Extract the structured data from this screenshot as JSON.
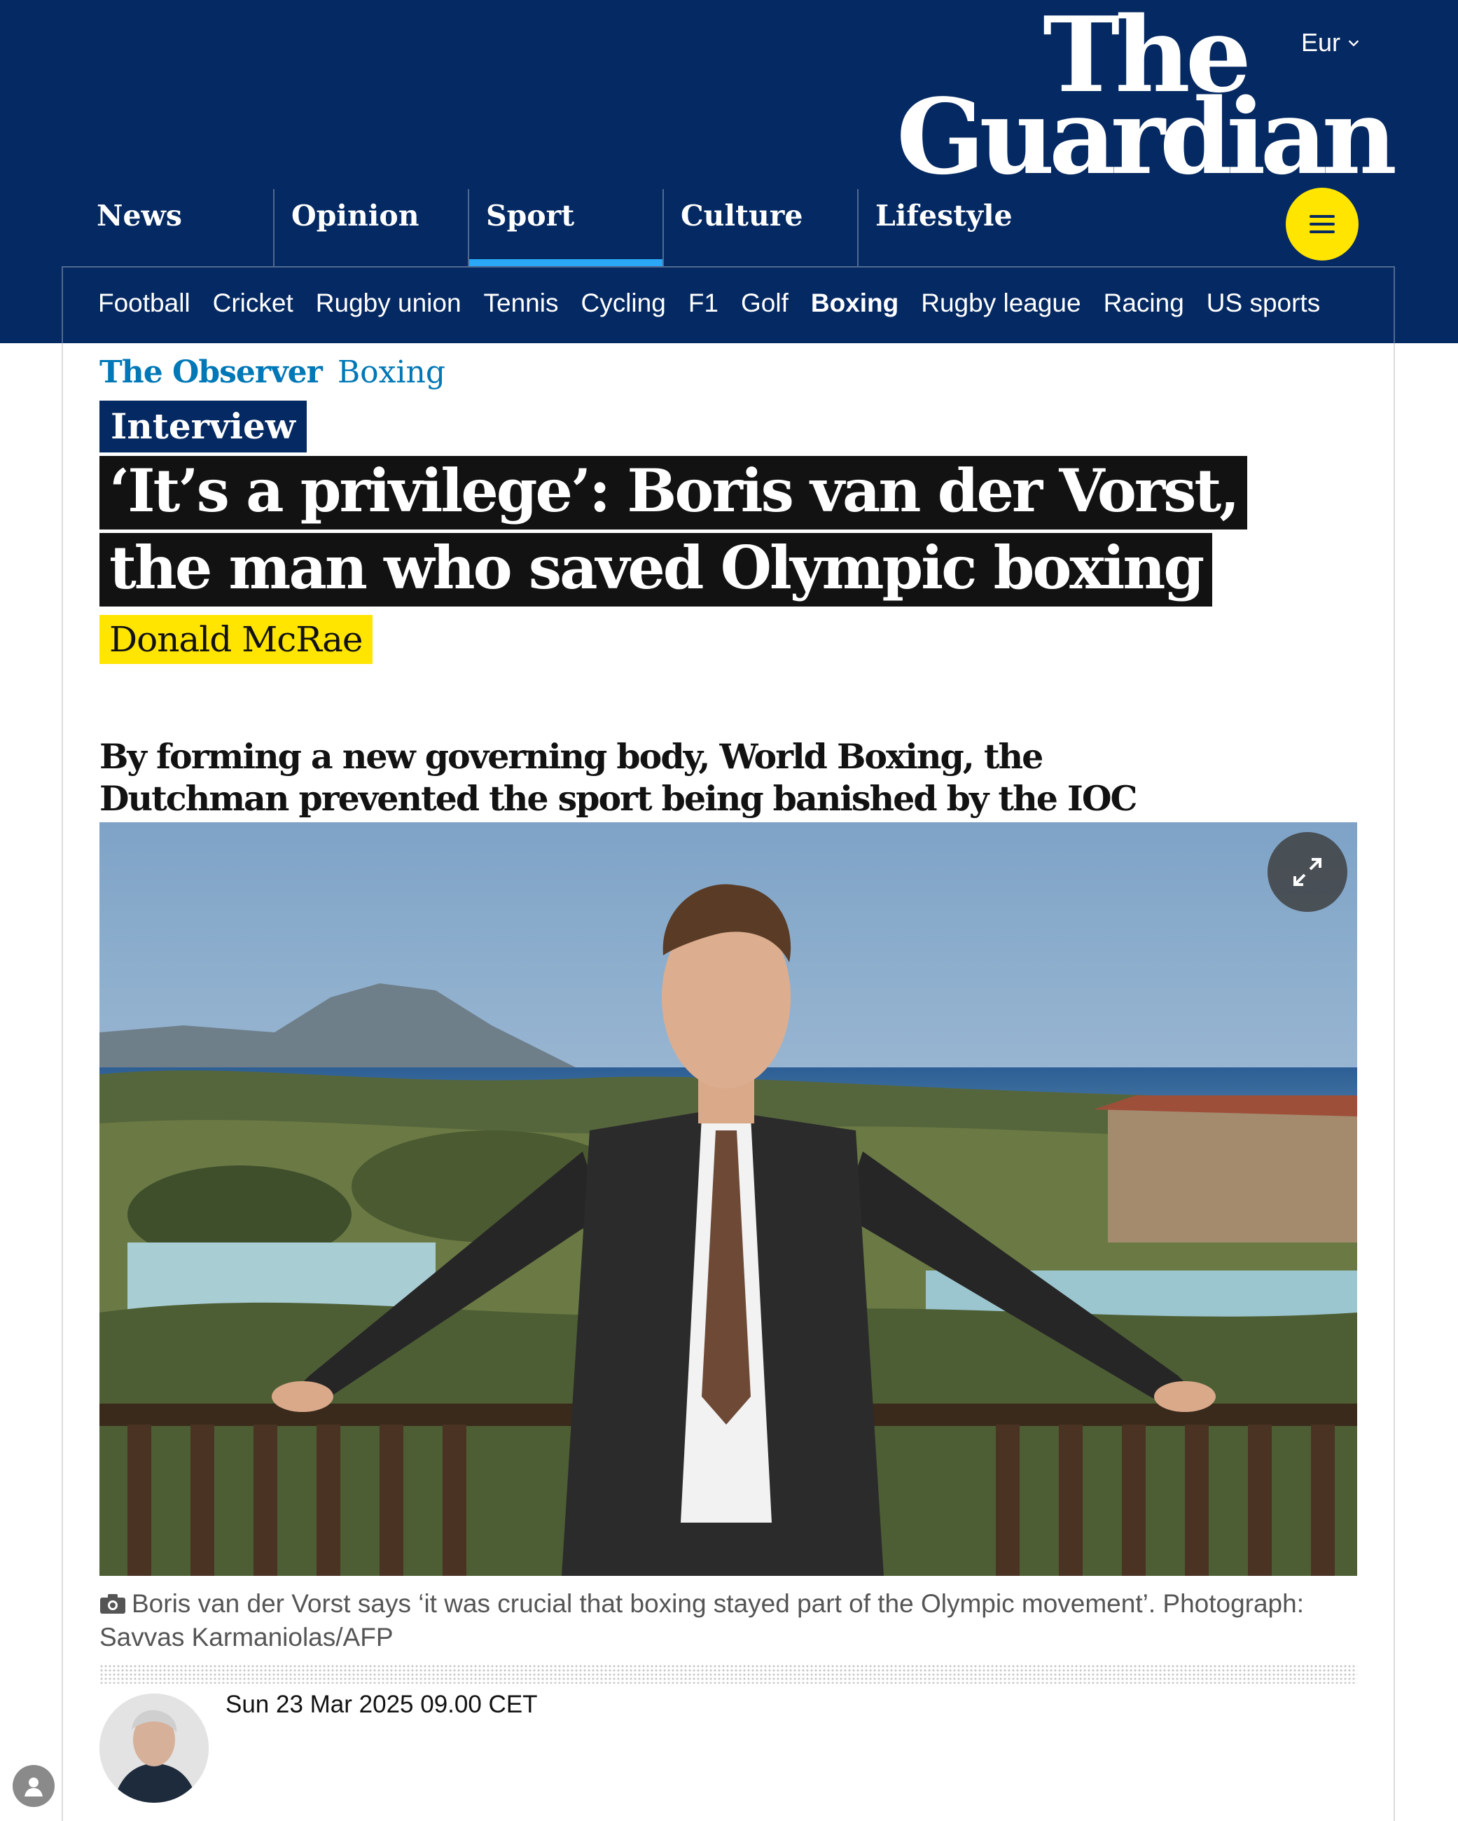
{
  "header": {
    "currency": "Eur",
    "logo_line1": "The",
    "logo_line2": "Guardian",
    "pillars": [
      "News",
      "Opinion",
      "Sport",
      "Culture",
      "Lifestyle"
    ],
    "active_pillar": "Sport",
    "subnav": [
      "Football",
      "Cricket",
      "Rugby union",
      "Tennis",
      "Cycling",
      "F1",
      "Golf",
      "Boxing",
      "Rugby league",
      "Racing",
      "US sports"
    ],
    "active_subnav": "Boxing",
    "menu_icon": "hamburger-icon"
  },
  "article": {
    "series": "The Observer",
    "section": "Boxing",
    "tag": "Interview",
    "headline": "‘It’s a privilege’: Boris van der Vorst, the man who saved Olympic boxing",
    "byline": "Donald McRae",
    "standfirst": "By forming a new governing body, World Boxing, the Dutchman prevented the sport being banished by the IOC",
    "caption": "Boris van der Vorst says ‘it was crucial that boxing stayed part of the Olympic movement’. Photograph: Savvas Karmaniolas/AFP",
    "dateline": "Sun 23 Mar 2025 09.00 CET"
  },
  "colors": {
    "brand_blue": "#052962",
    "highlight_yellow": "#ffe500",
    "sport_accent": "#2aa7f6",
    "kicker_blue": "#0077b6",
    "headline_bg": "#121212"
  }
}
